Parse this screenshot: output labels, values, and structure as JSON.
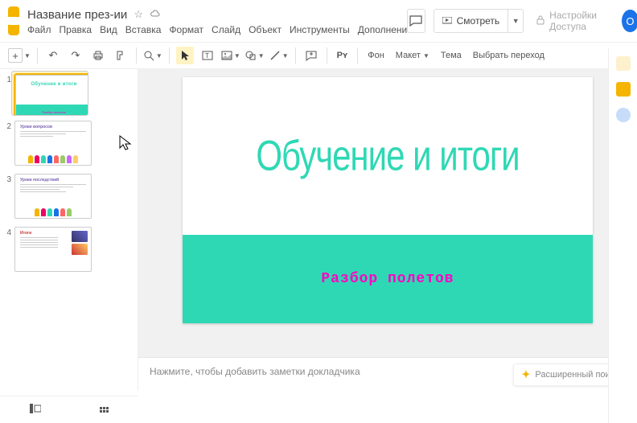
{
  "header": {
    "doc_title": "Название през-ии",
    "star_icon": "☆",
    "cloud_icon": "⊙",
    "comments_icon": "▤",
    "present_icon": "▶",
    "present_label": "Смотреть",
    "lock_icon": "🔒",
    "share_label": "Настройки Доступа",
    "avatar_letter": "O"
  },
  "menu": {
    "file": "Файл",
    "edit": "Правка",
    "view": "Вид",
    "insert": "Вставка",
    "format": "Формат",
    "slide": "Слайд",
    "object": "Объект",
    "tools": "Инструменты",
    "addons": "Дополнени"
  },
  "toolbar": {
    "new_plus": "+",
    "undo": "↶",
    "redo": "↷",
    "print": "⎙",
    "paint": "⟳",
    "zoom": "�askar",
    "cursor": "↖",
    "textbox": "T",
    "image": "▣",
    "shape": "◯",
    "line": "╲",
    "comment": "▤",
    "py": "Pʏ",
    "background": "Фон",
    "layout": "Макет",
    "theme": "Тема",
    "transition": "Выбрать переход"
  },
  "thumbnails": [
    {
      "num": "1",
      "title": "Обучение и итоги",
      "subtitle": "Разбор полетов"
    },
    {
      "num": "2",
      "title": "Уроки вопросов"
    },
    {
      "num": "3",
      "title": "Уроки последствий"
    },
    {
      "num": "4",
      "title": "Итоги"
    }
  ],
  "slide": {
    "title": "Обучение и итоги",
    "subtitle": "Разбор полетов"
  },
  "notes": {
    "placeholder": "Нажмите, чтобы добавить заметки докладчика",
    "adv_search": "Расширенный поиск"
  },
  "colors": {
    "accent": "#2fd8b4",
    "magenta": "#ff00c3",
    "brand_yellow": "#f4b400",
    "blue": "#1a73e8"
  }
}
